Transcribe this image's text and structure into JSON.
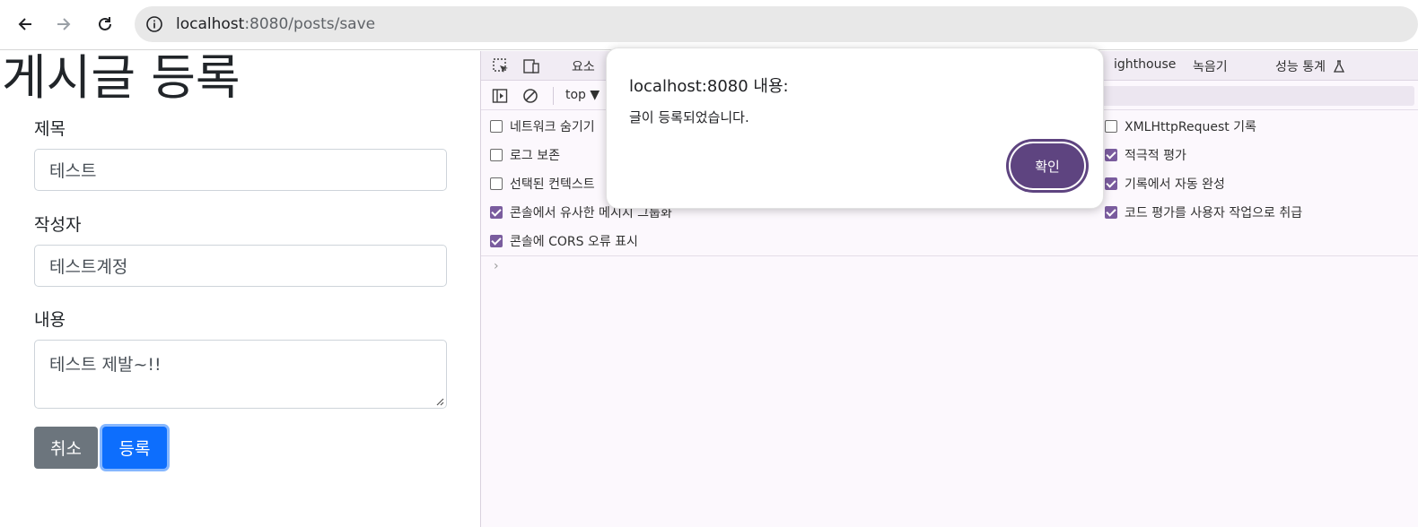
{
  "browser": {
    "url_host": "localhost",
    "url_rest": ":8080/posts/save"
  },
  "page": {
    "title": "게시글 등록",
    "fields": [
      {
        "label": "제목",
        "value": "테스트"
      },
      {
        "label": "작성자",
        "value": "테스트계정"
      },
      {
        "label": "내용",
        "value": "테스트 제발~!!"
      }
    ],
    "cancel_label": "취소",
    "submit_label": "등록"
  },
  "devtools": {
    "tabs": [
      "요소",
      "ighthouse",
      "녹음기",
      "성능 통계"
    ],
    "context": "top",
    "settings_left": [
      {
        "label": "네트워크 숨기기",
        "checked": false
      },
      {
        "label": "로그 보존",
        "checked": false
      },
      {
        "label": "선택된 컨텍스트",
        "checked": false
      },
      {
        "label": "콘솔에서 유사한 메시지 그룹화",
        "checked": true
      },
      {
        "label": "콘솔에 CORS 오류 표시",
        "checked": true
      }
    ],
    "settings_right": [
      {
        "label": "XMLHttpRequest 기록",
        "checked": false
      },
      {
        "label": "적극적 평가",
        "checked": true
      },
      {
        "label": "기록에서 자동 완성",
        "checked": true
      },
      {
        "label": "코드 평가를 사용자 작업으로 취급",
        "checked": true
      }
    ]
  },
  "dialog": {
    "title": "localhost:8080 내용:",
    "message": "글이 등록되었습니다.",
    "ok_label": "확인"
  },
  "colors": {
    "submit": "#0d6efd",
    "cancel": "#6c757d",
    "dialog_button": "#5e4480",
    "checkbox": "#7a5c9e"
  }
}
